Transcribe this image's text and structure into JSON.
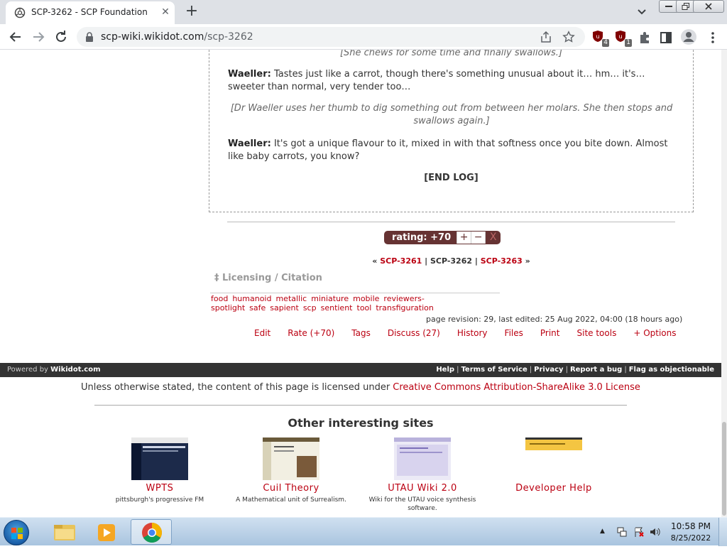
{
  "browser": {
    "tab_title": "SCP-3262 - SCP Foundation",
    "url_host": "scp-wiki.wikidot.com",
    "url_path": "/scp-3262",
    "extension_badges": [
      "4",
      "1"
    ]
  },
  "log": {
    "stage_1": "[She chews for some time and finally swallows.]",
    "dialog_1_speaker": "Waeller:",
    "dialog_1_text": " Tastes just like a carrot, though there's something unusual about it… hm… it's… sweeter than normal, very tender too…",
    "stage_2": "[Dr Waeller uses her thumb to dig something out from between her molars. She then stops and swallows again.]",
    "dialog_2_speaker": "Waeller:",
    "dialog_2_text": " It's got a unique flavour to it, mixed in with that softness once you bite down. Almost like baby carrots, you know?",
    "end": "[END LOG]"
  },
  "rating": {
    "label": "rating: +70",
    "plus": "+",
    "minus": "−",
    "cancel": "X"
  },
  "series_nav": {
    "prev_arrow": "«",
    "prev": "SCP-3261",
    "sep1": " | ",
    "current": "SCP-3262",
    "sep2": " | ",
    "next": "SCP-3263",
    "next_arrow": "»"
  },
  "licensing": "‡ Licensing / Citation",
  "tags": [
    "food",
    "humanoid",
    "metallic",
    "miniature",
    "mobile",
    "reviewers-spotlight",
    "safe",
    "sapient",
    "scp",
    "sentient",
    "tool",
    "transfiguration"
  ],
  "page_info": "page revision: 29, last edited: 25 Aug 2022, 04:00 (18 hours ago)",
  "page_options": [
    "Edit",
    "Rate (+70)",
    "Tags",
    "Discuss (27)",
    "History",
    "Files",
    "Print",
    "Site tools",
    "+ Options"
  ],
  "footer": {
    "powered_prefix": "Powered by ",
    "powered_brand": "Wikidot.com",
    "links": [
      "Help",
      "Terms of Service",
      "Privacy",
      "Report a bug",
      "Flag as objectionable"
    ],
    "separator": "|"
  },
  "license": {
    "prefix": "Unless otherwise stated, the content of this page is licensed under ",
    "link": "Creative Commons Attribution-ShareAlike 3.0 License"
  },
  "other_sites": {
    "title": "Other interesting sites",
    "sites": [
      {
        "name": "WPTS",
        "desc": "pittsburgh's progressive FM"
      },
      {
        "name": "Cuil Theory",
        "desc": "A Mathematical unit of Surrealism."
      },
      {
        "name": "UTAU Wiki 2.0",
        "desc": "Wiki for the UTAU voice synthesis software."
      },
      {
        "name": "Developer Help",
        "desc": ""
      }
    ]
  },
  "taskbar": {
    "time": "10:58 PM",
    "date": "8/25/2022"
  },
  "colors": {
    "link": "#bb0011",
    "rating_bg": "#663333",
    "footer_bg": "#333333"
  }
}
